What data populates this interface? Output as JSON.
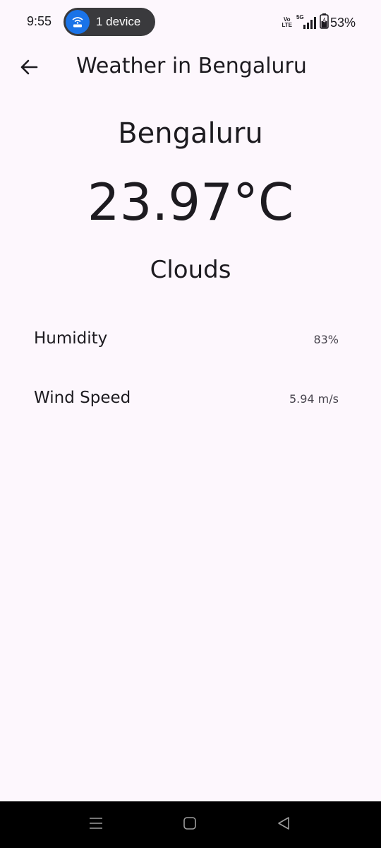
{
  "status_bar": {
    "time": "9:55",
    "hotspot_label": "1 device",
    "volte_top": "Vo",
    "volte_bottom": "LTE",
    "network_type": "5G",
    "battery_percent": "53%",
    "battery_level": 0.53,
    "hotspot_color": "#1a73e8"
  },
  "app_bar": {
    "title": "Weather in Bengaluru",
    "back_icon": "arrow-left-icon"
  },
  "weather": {
    "city": "Bengaluru",
    "temperature": "23.97°C",
    "condition": "Clouds",
    "details": [
      {
        "label": "Humidity",
        "value": "83%"
      },
      {
        "label": "Wind Speed",
        "value": "5.94 m/s"
      }
    ]
  },
  "nav_bar": {
    "recents_icon": "recents-icon",
    "home_icon": "home-icon",
    "back_icon": "back-triangle-icon"
  },
  "colors": {
    "background": "#fdf7fd",
    "text_primary": "#1d1b20",
    "text_secondary": "#49454f",
    "nav_background": "#000000"
  }
}
